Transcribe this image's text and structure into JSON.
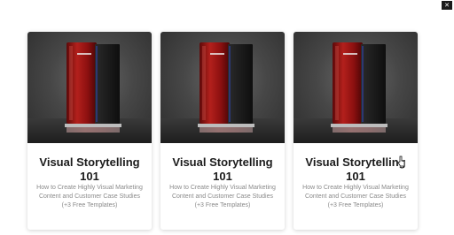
{
  "corner_button": {
    "glyph": "✕"
  },
  "cards": [
    {
      "title": "Visual Storytelling 101",
      "description": "How to Create Highly Visual Marketing Content and Customer Case Studies (+3 Free Templates)",
      "image": "red-metal-cabinet-illustration"
    },
    {
      "title": "Visual Storytelling 101",
      "description": "How to Create Highly Visual Marketing Content and Customer Case Studies (+3 Free Templates)",
      "image": "red-metal-cabinet-illustration"
    },
    {
      "title": "Visual Storytelling 101",
      "description": "How to Create Highly Visual Marketing Content and Customer Case Studies (+3 Free Templates)",
      "image": "red-metal-cabinet-illustration"
    }
  ],
  "colors": {
    "cabinet_red": "#9a1414",
    "cabinet_dark": "#1c1c1c",
    "title_text": "#1b1b1b",
    "description_text": "#8a8a8a"
  }
}
